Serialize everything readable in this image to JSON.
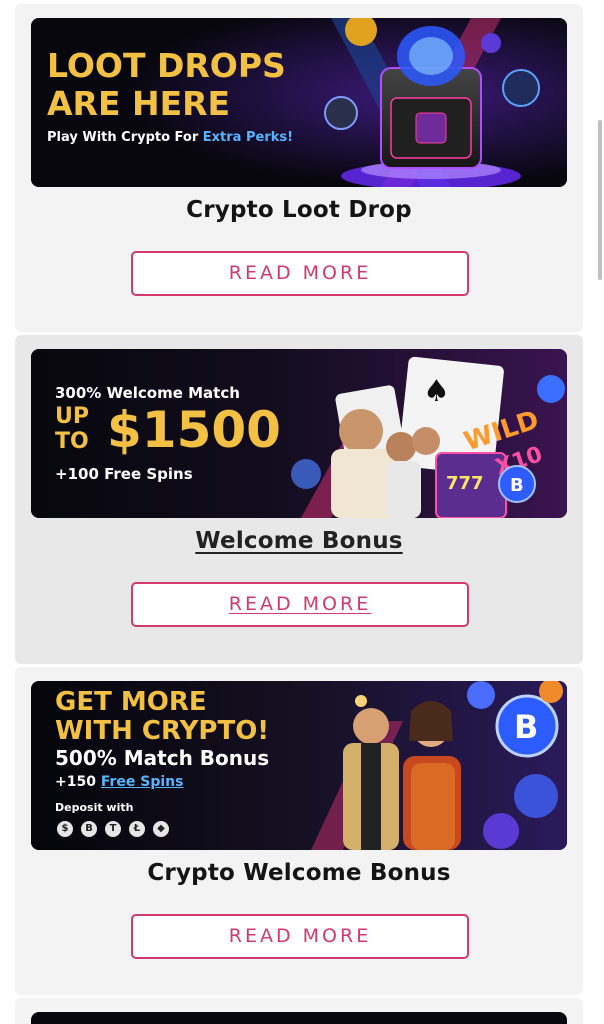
{
  "promos": [
    {
      "title": "Crypto Loot Drop",
      "button_label": "READ MORE",
      "banner": {
        "headline_line1": "LOOT DROPS",
        "headline_line2": "ARE HERE",
        "tagline_lead": "Play With Crypto For ",
        "tagline_highlight": "Extra Perks!"
      }
    },
    {
      "title": "Welcome Bonus",
      "button_label": "READ MORE",
      "banner": {
        "match_line": "300% Welcome Match",
        "up_label": "UP",
        "to_label": "TO",
        "amount": "$1500",
        "spins_line": "+100 Free Spins",
        "sign_text": "WILD X10"
      }
    },
    {
      "title": "Crypto Welcome Bonus",
      "button_label": "READ MORE",
      "banner": {
        "headline_line1": "GET MORE",
        "headline_line2": "WITH CRYPTO!",
        "match_line": "500% Match Bonus",
        "spins_lead": "+150 ",
        "spins_highlight": "Free Spins",
        "deposit_label": "Deposit with",
        "coins": [
          "$",
          "B",
          "T",
          "Ł",
          "◆"
        ]
      }
    }
  ],
  "colors": {
    "accent_pink": "#d23a6b",
    "gold": "#f2c143",
    "highlight_blue": "#55b6ff"
  }
}
